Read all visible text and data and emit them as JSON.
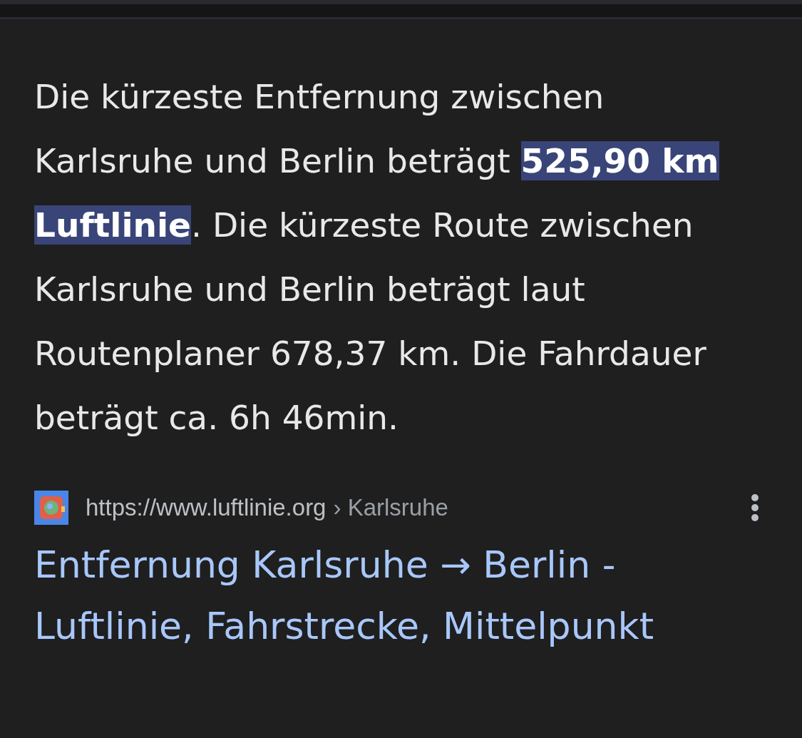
{
  "snippet": "Die kürzeste Entfernung zwischen Karlsruhe und Berlin beträgt **525,90 km Luftlinie**. Die kürzeste Route zwischen Karlsruhe und Berlin beträgt laut Routenplaner 678,37 km. Die Fahrdauer beträgt ca. 6h 46min.",
  "source": {
    "url": "https://www.luftlinie.org",
    "breadcrumb": "› Karlsruhe",
    "title": "Entfernung Karlsruhe → Berlin - Luftlinie, Fahrstrecke, Mittelpunkt"
  }
}
